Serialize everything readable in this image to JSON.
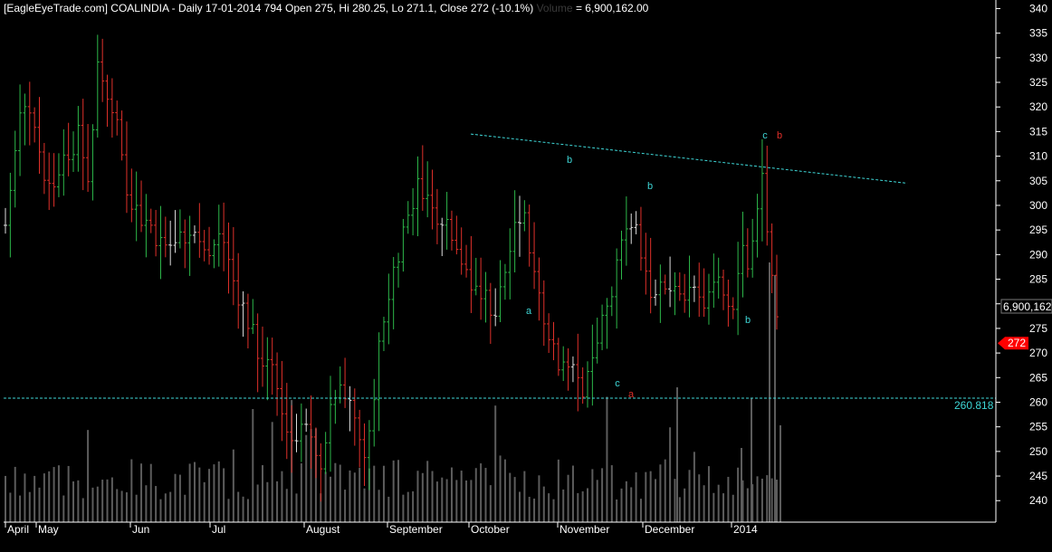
{
  "header": {
    "title": "[EagleEyeTrade.com] COALINDIA - Daily 17-01-2014 794 Open 275, Hi 280.25, Lo 271.1, Close 272 (-10.1%)",
    "volume_label": "Volume",
    "volume_value": "= 6,900,162.00"
  },
  "colors": {
    "background": "#000000",
    "up_bar": "#2db84a",
    "down_bar": "#e0302a",
    "neutral_bar": "#dddddd",
    "trend_line": "#3ed6d6",
    "axis_text": "#ffffff",
    "volume_bar": "#5c5c5c",
    "price_tag": "#ff0000"
  },
  "chart_data": {
    "type": "ohlc",
    "price_axis": {
      "ylim": [
        236,
        341
      ],
      "ticks": [
        240,
        245,
        250,
        255,
        260,
        265,
        270,
        275,
        280,
        285,
        290,
        295,
        300,
        305,
        310,
        315,
        320,
        325,
        330,
        335,
        340
      ]
    },
    "x_axis_labels": [
      "April",
      "May",
      "Jun",
      "Jul",
      "August",
      "September",
      "October",
      "November",
      "December",
      "2014"
    ],
    "support_level": {
      "value": 260.818,
      "label": "260.818"
    },
    "trend_line_values": [
      314.5,
      304.5
    ],
    "last_volume_label": "6,900,162",
    "last_price_label": "272",
    "wave_labels": [
      "a",
      "b",
      "c",
      "a",
      "b",
      "c",
      "a",
      "b",
      "c",
      "b"
    ],
    "grid": false
  }
}
